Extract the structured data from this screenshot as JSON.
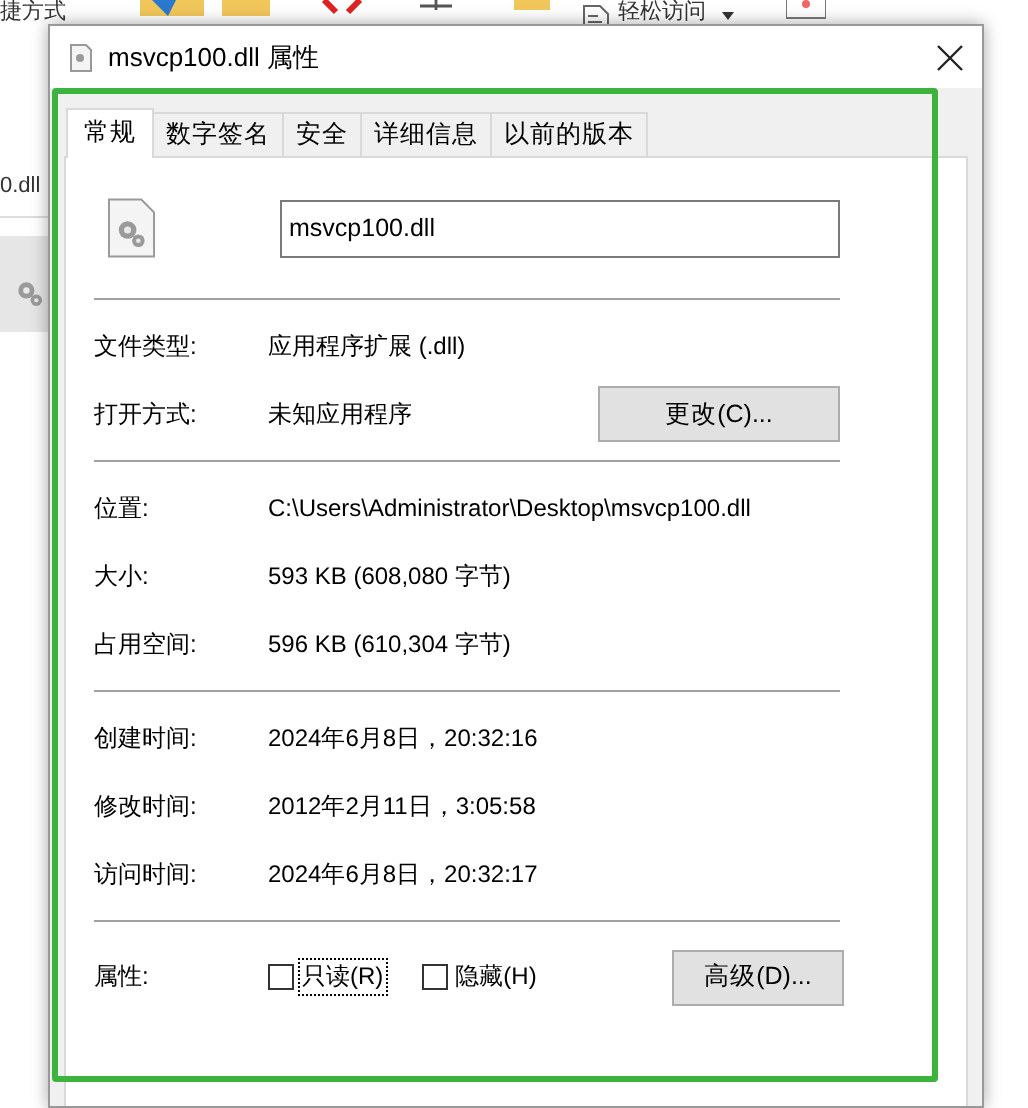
{
  "background": {
    "toolbar_labels": [
      "捷方式",
      "轻松访问"
    ],
    "file_label": "0.dll"
  },
  "window": {
    "title": "msvcp100.dll 属性"
  },
  "tabs": [
    {
      "label": "常规",
      "selected": true
    },
    {
      "label": "数字签名",
      "selected": false
    },
    {
      "label": "安全",
      "selected": false
    },
    {
      "label": "详细信息",
      "selected": false
    },
    {
      "label": "以前的版本",
      "selected": false
    }
  ],
  "name_field": {
    "value": "msvcp100.dll"
  },
  "sections": [
    [
      {
        "label": "文件类型:",
        "value": "应用程序扩展 (.dll)"
      },
      {
        "label": "打开方式:",
        "value": "未知应用程序",
        "button": "更改(C)..."
      }
    ],
    [
      {
        "label": "位置:",
        "value": "C:\\Users\\Administrator\\Desktop\\msvcp100.dll"
      },
      {
        "label": "大小:",
        "value": "593 KB (608,080 字节)"
      },
      {
        "label": "占用空间:",
        "value": "596 KB (610,304 字节)"
      }
    ],
    [
      {
        "label": "创建时间:",
        "value": "2024年6月8日，20:32:16"
      },
      {
        "label": "修改时间:",
        "value": "2012年2月11日，3:05:58"
      },
      {
        "label": "访问时间:",
        "value": "2024年6月8日，20:32:17"
      }
    ]
  ],
  "attributes": {
    "label": "属性:",
    "checkboxes": [
      {
        "label": "只读(R)",
        "checked": false,
        "focused": true
      },
      {
        "label": "隐藏(H)",
        "checked": false,
        "focused": false
      }
    ],
    "button": "高级(D)..."
  }
}
